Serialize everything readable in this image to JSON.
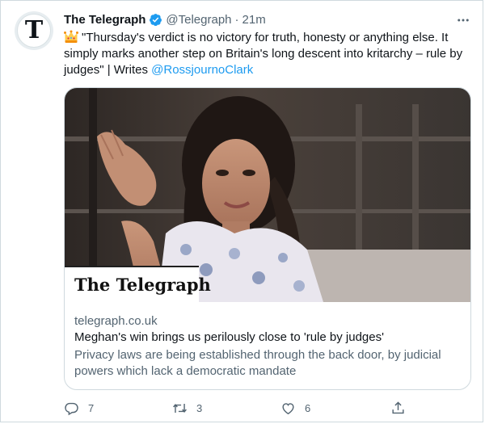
{
  "author": {
    "name": "The Telegraph",
    "handle": "@Telegraph",
    "separator": "·",
    "time": "21m",
    "avatar_glyph": "T",
    "verified": true
  },
  "tweet": {
    "emoji_icon": "crown-icon",
    "text": "\"Thursday's verdict is no victory for truth, honesty or anything else. It simply marks another step on Britain's long descent into kritarchy – rule by judges\" | Writes ",
    "mention": "@RossjournoClark"
  },
  "card": {
    "logo_text": "The Telegraph",
    "domain": "telegraph.co.uk",
    "title": "Meghan's win brings us perilously close to 'rule by judges'",
    "description": "Privacy laws are being established through the back door, by judicial powers which lack a democratic mandate"
  },
  "actions": {
    "reply_count": "7",
    "retweet_count": "3",
    "like_count": "6"
  },
  "colors": {
    "accent": "#1d9bf0",
    "secondary_text": "#536471",
    "primary_text": "#0f1419",
    "border": "#cfd9de"
  }
}
